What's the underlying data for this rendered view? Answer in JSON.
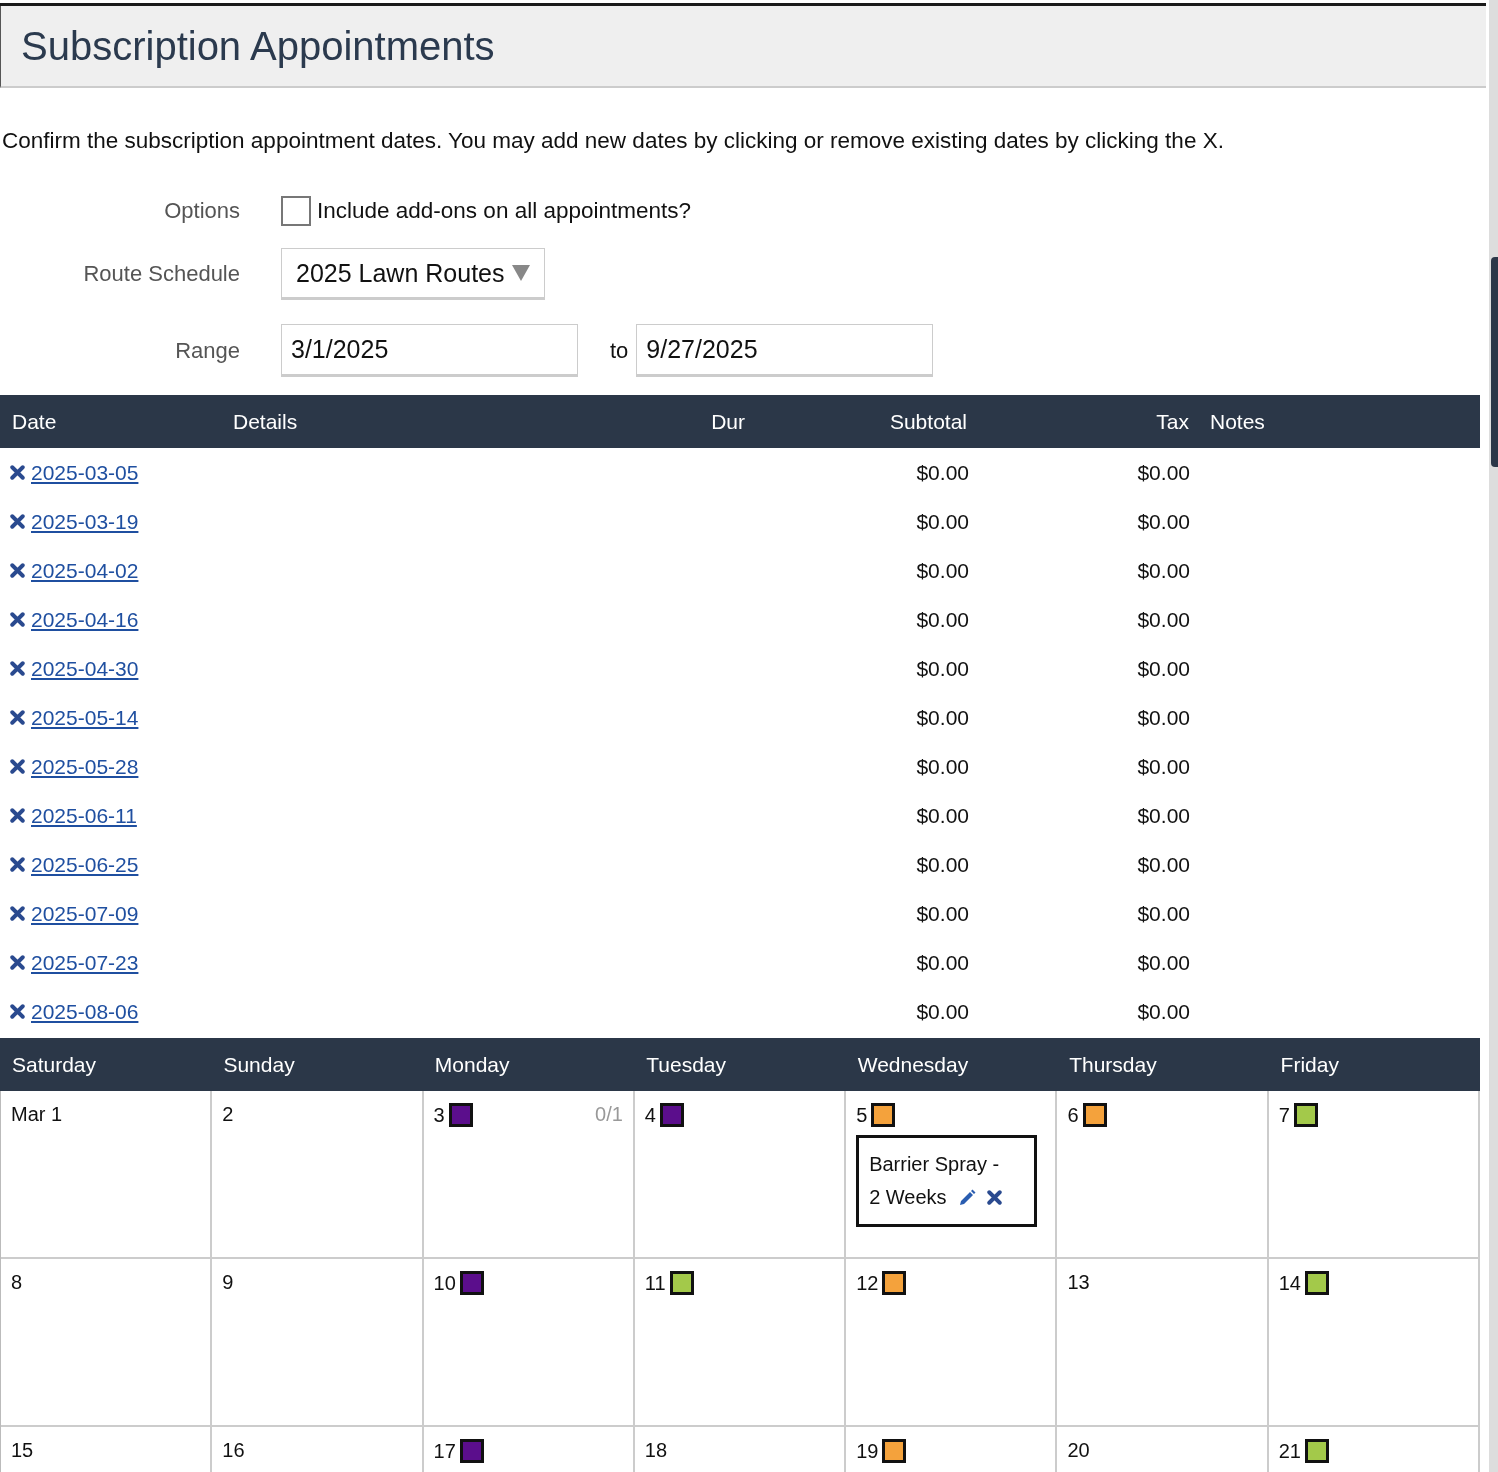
{
  "page": {
    "title": "Subscription Appointments",
    "description": "Confirm the subscription appointment dates. You may add new dates by clicking or remove existing dates by clicking the X."
  },
  "form": {
    "options_label": "Options",
    "addons": {
      "label": "Include add-ons on all appointments?",
      "checked": false
    },
    "route_label": "Route Schedule",
    "route_value": "2025 Lawn Routes",
    "range_label": "Range",
    "range_from": "3/1/2025",
    "range_to_label": "to",
    "range_to": "9/27/2025"
  },
  "table": {
    "columns": [
      "Date",
      "Details",
      "Dur",
      "Subtotal",
      "Tax",
      "Notes"
    ],
    "rows": [
      {
        "date": "2025-03-05",
        "subtotal": "$0.00",
        "tax": "$0.00"
      },
      {
        "date": "2025-03-19",
        "subtotal": "$0.00",
        "tax": "$0.00"
      },
      {
        "date": "2025-04-02",
        "subtotal": "$0.00",
        "tax": "$0.00"
      },
      {
        "date": "2025-04-16",
        "subtotal": "$0.00",
        "tax": "$0.00"
      },
      {
        "date": "2025-04-30",
        "subtotal": "$0.00",
        "tax": "$0.00"
      },
      {
        "date": "2025-05-14",
        "subtotal": "$0.00",
        "tax": "$0.00"
      },
      {
        "date": "2025-05-28",
        "subtotal": "$0.00",
        "tax": "$0.00"
      },
      {
        "date": "2025-06-11",
        "subtotal": "$0.00",
        "tax": "$0.00"
      },
      {
        "date": "2025-06-25",
        "subtotal": "$0.00",
        "tax": "$0.00"
      },
      {
        "date": "2025-07-09",
        "subtotal": "$0.00",
        "tax": "$0.00"
      },
      {
        "date": "2025-07-23",
        "subtotal": "$0.00",
        "tax": "$0.00"
      },
      {
        "date": "2025-08-06",
        "subtotal": "$0.00",
        "tax": "$0.00"
      }
    ]
  },
  "calendar": {
    "weekdays": [
      "Saturday",
      "Sunday",
      "Monday",
      "Tuesday",
      "Wednesday",
      "Thursday",
      "Friday"
    ],
    "days": [
      {
        "label": "Mar 1"
      },
      {
        "label": "2"
      },
      {
        "label": "3",
        "color": "#5b0e8c",
        "count": "0/1"
      },
      {
        "label": "4",
        "color": "#5b0e8c"
      },
      {
        "label": "5",
        "color": "#f4a23c",
        "event": {
          "line1": "Barrier Spray -",
          "line2": "2 Weeks"
        }
      },
      {
        "label": "6",
        "color": "#f4a23c"
      },
      {
        "label": "7",
        "color": "#a3c94a"
      },
      {
        "label": "8"
      },
      {
        "label": "9"
      },
      {
        "label": "10",
        "color": "#5b0e8c"
      },
      {
        "label": "11",
        "color": "#a3c94a"
      },
      {
        "label": "12",
        "color": "#f4a23c"
      },
      {
        "label": "13"
      },
      {
        "label": "14",
        "color": "#a3c94a"
      },
      {
        "label": "15"
      },
      {
        "label": "16"
      },
      {
        "label": "17",
        "color": "#5b0e8c"
      },
      {
        "label": "18"
      },
      {
        "label": "19",
        "color": "#f4a23c"
      },
      {
        "label": "20"
      },
      {
        "label": "21",
        "color": "#a3c94a"
      }
    ]
  }
}
